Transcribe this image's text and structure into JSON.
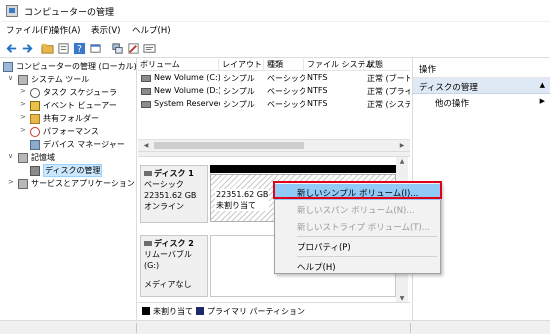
{
  "window": {
    "title": "コンピューターの管理"
  },
  "menu": [
    "ファイル(F)",
    "操作(A)",
    "表示(V)",
    "ヘルプ(H)"
  ],
  "toolbar": [
    "back-icon",
    "forward-icon",
    "up-folder-icon",
    "properties-icon",
    "help-icon",
    "refresh-icon",
    "export-icon",
    "settings-icon",
    "view-icon"
  ],
  "tree": {
    "root": "コンピューターの管理 (ローカル)",
    "system_tools": "システム ツール",
    "task_scheduler": "タスク スケジューラ",
    "event_viewer": "イベント ビューアー",
    "shared_folders": "共有フォルダー",
    "performance": "パフォーマンス",
    "device_manager": "デバイス マネージャー",
    "storage": "記憶域",
    "disk_management": "ディスクの管理",
    "services": "サービスとアプリケーション"
  },
  "volumes": {
    "headers": [
      "ボリューム",
      "レイアウト",
      "種類",
      "ファイル システム",
      "状態"
    ],
    "rows": [
      [
        "New Volume (C:)",
        "シンプル",
        "ベーシック",
        "NTFS",
        "正常 (ブート,"
      ],
      [
        "New Volume (D:)",
        "シンプル",
        "ベーシック",
        "NTFS",
        "正常 (プライマ"
      ],
      [
        "System Reserved",
        "シンプル",
        "ベーシック",
        "NTFS",
        "正常 (システ"
      ]
    ]
  },
  "disks": {
    "disk1": {
      "name": "ディスク 1",
      "type": "ベーシック",
      "size": "22351.62 GB",
      "status": "オンライン",
      "part_size": "22351.62 GB",
      "part_state": "未割り当て"
    },
    "disk2": {
      "name": "ディスク 2",
      "type": "リムーバブル (G:)",
      "status": "メディアなし"
    }
  },
  "legend": {
    "unallocated": "未割り当て",
    "primary": "プライマリ パーティション",
    "unallocated_color": "#000000",
    "primary_color": "#1f2a6b"
  },
  "actions": {
    "header": "操作",
    "section": "ディスクの管理",
    "other": "他の操作"
  },
  "context_menu": {
    "items": [
      "新しいシンプル ボリューム(I)...",
      "新しいスパン ボリューム(N)...",
      "新しいストライプ ボリューム(T)...",
      "プロパティ(P)",
      "ヘルプ(H)"
    ],
    "highlight_color": "#e0001a"
  }
}
